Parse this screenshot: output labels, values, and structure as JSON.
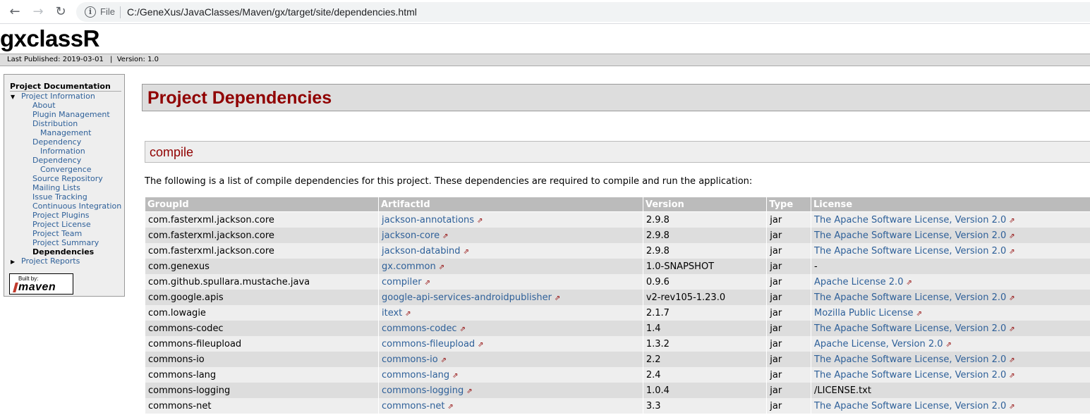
{
  "browser": {
    "scheme_label": "File",
    "url": "C:/GeneXus/JavaClasses/Maven/gx/target/site/dependencies.html",
    "back_glyph": "←",
    "forward_glyph": "→",
    "reload_glyph": "↻",
    "info_glyph": "i"
  },
  "site": {
    "name": "gxclassR",
    "last_published": "Last Published: 2019-03-01",
    "version": "|  Version: 1.0"
  },
  "nav": {
    "heading": "Project Documentation",
    "project_information": "Project Information",
    "items": [
      {
        "label": "About",
        "indent": "l2"
      },
      {
        "label": "Plugin Management",
        "indent": "l2"
      },
      {
        "label": "Distribution",
        "indent": "l2"
      },
      {
        "label": "Management",
        "indent": "l2b"
      },
      {
        "label": "Dependency",
        "indent": "l2"
      },
      {
        "label": "Information",
        "indent": "l2b"
      },
      {
        "label": "Dependency",
        "indent": "l2"
      },
      {
        "label": "Convergence",
        "indent": "l2b"
      },
      {
        "label": "Source Repository",
        "indent": "l2"
      },
      {
        "label": "Mailing Lists",
        "indent": "l2"
      },
      {
        "label": "Issue Tracking",
        "indent": "l2"
      },
      {
        "label": "Continuous Integration",
        "indent": "l2"
      },
      {
        "label": "Project Plugins",
        "indent": "l2"
      },
      {
        "label": "Project License",
        "indent": "l2"
      },
      {
        "label": "Project Team",
        "indent": "l2"
      },
      {
        "label": "Project Summary",
        "indent": "l2"
      },
      {
        "label": "Dependencies",
        "indent": "l2",
        "active": true
      }
    ],
    "project_reports": "Project Reports",
    "built_by_small": "Built by:",
    "built_by_logo": "maven"
  },
  "content": {
    "title": "Project Dependencies",
    "section": "compile",
    "intro": "The following is a list of compile dependencies for this project. These dependencies are required to compile and run the application:",
    "columns": [
      "GroupId",
      "ArtifactId",
      "Version",
      "Type",
      "License"
    ],
    "rows": [
      {
        "group": "com.fasterxml.jackson.core",
        "artifact": "jackson-annotations",
        "version": "2.9.8",
        "type": "jar",
        "license": "The Apache Software License, Version 2.0",
        "license_link": true
      },
      {
        "group": "com.fasterxml.jackson.core",
        "artifact": "jackson-core",
        "version": "2.9.8",
        "type": "jar",
        "license": "The Apache Software License, Version 2.0",
        "license_link": true
      },
      {
        "group": "com.fasterxml.jackson.core",
        "artifact": "jackson-databind",
        "version": "2.9.8",
        "type": "jar",
        "license": "The Apache Software License, Version 2.0",
        "license_link": true
      },
      {
        "group": "com.genexus",
        "artifact": "gx.common",
        "version": "1.0-SNAPSHOT",
        "type": "jar",
        "license": "-",
        "license_link": false
      },
      {
        "group": "com.github.spullara.mustache.java",
        "artifact": "compiler",
        "version": "0.9.6",
        "type": "jar",
        "license": "Apache License 2.0",
        "license_link": true
      },
      {
        "group": "com.google.apis",
        "artifact": "google-api-services-androidpublisher",
        "version": "v2-rev105-1.23.0",
        "type": "jar",
        "license": "The Apache Software License, Version 2.0",
        "license_link": true
      },
      {
        "group": "com.lowagie",
        "artifact": "itext",
        "version": "2.1.7",
        "type": "jar",
        "license": "Mozilla Public License",
        "license_link": true
      },
      {
        "group": "commons-codec",
        "artifact": "commons-codec",
        "version": "1.4",
        "type": "jar",
        "license": "The Apache Software License, Version 2.0",
        "license_link": true
      },
      {
        "group": "commons-fileupload",
        "artifact": "commons-fileupload",
        "version": "1.3.2",
        "type": "jar",
        "license": "Apache License, Version 2.0",
        "license_link": true
      },
      {
        "group": "commons-io",
        "artifact": "commons-io",
        "version": "2.2",
        "type": "jar",
        "license": "The Apache Software License, Version 2.0",
        "license_link": true
      },
      {
        "group": "commons-lang",
        "artifact": "commons-lang",
        "version": "2.4",
        "type": "jar",
        "license": "The Apache Software License, Version 2.0",
        "license_link": true
      },
      {
        "group": "commons-logging",
        "artifact": "commons-logging",
        "version": "1.0.4",
        "type": "jar",
        "license": "/LICENSE.txt",
        "license_link": false
      },
      {
        "group": "commons-net",
        "artifact": "commons-net",
        "version": "3.3",
        "type": "jar",
        "license": "The Apache Software License, Version 2.0",
        "license_link": true
      }
    ]
  },
  "colors": {
    "link": "#2e6099",
    "heading": "#900000",
    "table_header_bg": "#bbbbbb",
    "row_a": "#eeeeee",
    "row_b": "#dddddd"
  },
  "icons": {
    "external_link": "external-link-icon",
    "info": "info-icon",
    "triangle_expanded": "▼",
    "triangle_collapsed": "▶"
  }
}
